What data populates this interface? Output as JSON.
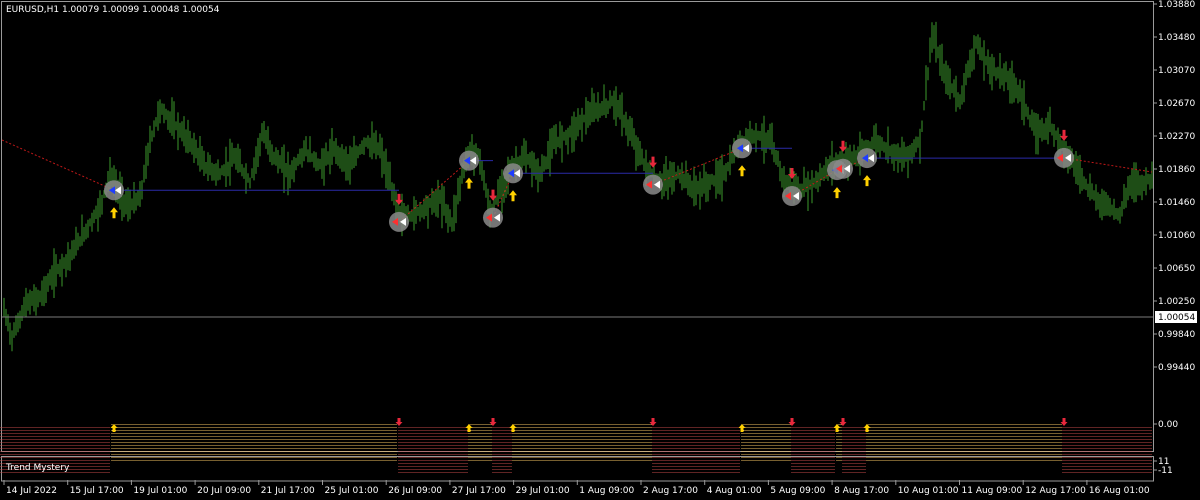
{
  "window": {
    "symbol_header": "EURUSD,H1  1.00079 1.00099 1.00048 1.00054",
    "current_price": "1.00054"
  },
  "price_axis": {
    "labels": [
      "1.03880",
      "1.03480",
      "1.03070",
      "1.02670",
      "1.02270",
      "1.01860",
      "1.01460",
      "1.01060",
      "1.00650",
      "1.00250",
      "0.99840",
      "0.99440"
    ]
  },
  "indicator": {
    "name": "Trend Mystery",
    "axis_labels": [
      "11",
      "0.00",
      "-11"
    ]
  },
  "time_axis": {
    "labels": [
      "14 Jul 2022",
      "15 Jul 17:00",
      "19 Jul 01:00",
      "20 Jul 09:00",
      "21 Jul 17:00",
      "25 Jul 01:00",
      "26 Jul 09:00",
      "27 Jul 17:00",
      "29 Jul 01:00",
      "1 Aug 09:00",
      "2 Aug 17:00",
      "4 Aug 01:00",
      "5 Aug 09:00",
      "8 Aug 17:00",
      "10 Aug 01:00",
      "11 Aug 09:00",
      "12 Aug 17:00",
      "16 Aug 01:00"
    ]
  },
  "colors": {
    "background": "#000000",
    "grid": "#232323",
    "candles": "#3c9a2c",
    "bull_histogram": "#f0c060",
    "bear_histogram": "#c04848",
    "buy_arrow": "#ffd000",
    "sell_arrow": "#e8283c",
    "trend_line_flat": "#2a2aa8",
    "trend_line_dotted": "#c01818"
  },
  "chart_data": {
    "type": "line",
    "title": "EURUSD,H1",
    "ylim": [
      0.9944,
      1.0388
    ],
    "price_path": [
      [
        0,
        1.003
      ],
      [
        12,
        0.998
      ],
      [
        25,
        1.002
      ],
      [
        40,
        1.003
      ],
      [
        55,
        1.006
      ],
      [
        70,
        1.008
      ],
      [
        85,
        1.011
      ],
      [
        100,
        1.014
      ],
      [
        110,
        1.018
      ],
      [
        118,
        1.016
      ],
      [
        128,
        1.014
      ],
      [
        140,
        1.015
      ],
      [
        150,
        1.022
      ],
      [
        160,
        1.026
      ],
      [
        175,
        1.024
      ],
      [
        190,
        1.022
      ],
      [
        205,
        1.019
      ],
      [
        220,
        1.018
      ],
      [
        235,
        1.02
      ],
      [
        250,
        1.017
      ],
      [
        262,
        1.023
      ],
      [
        275,
        1.02
      ],
      [
        290,
        1.018
      ],
      [
        305,
        1.021
      ],
      [
        320,
        1.019
      ],
      [
        335,
        1.021
      ],
      [
        350,
        1.019
      ],
      [
        365,
        1.022
      ],
      [
        380,
        1.021
      ],
      [
        392,
        1.016
      ],
      [
        400,
        1.013
      ],
      [
        412,
        1.013
      ],
      [
        425,
        1.014
      ],
      [
        440,
        1.015
      ],
      [
        452,
        1.012
      ],
      [
        462,
        1.018
      ],
      [
        470,
        1.021
      ],
      [
        480,
        1.02
      ],
      [
        490,
        1.013
      ],
      [
        500,
        1.016
      ],
      [
        512,
        1.019
      ],
      [
        525,
        1.02
      ],
      [
        540,
        1.018
      ],
      [
        555,
        1.022
      ],
      [
        570,
        1.023
      ],
      [
        585,
        1.025
      ],
      [
        600,
        1.026
      ],
      [
        615,
        1.027
      ],
      [
        630,
        1.023
      ],
      [
        645,
        1.019
      ],
      [
        660,
        1.017
      ],
      [
        680,
        1.018
      ],
      [
        695,
        1.016
      ],
      [
        710,
        1.017
      ],
      [
        725,
        1.018
      ],
      [
        740,
        1.022
      ],
      [
        755,
        1.023
      ],
      [
        770,
        1.022
      ],
      [
        785,
        1.017
      ],
      [
        800,
        1.016
      ],
      [
        815,
        1.017
      ],
      [
        830,
        1.019
      ],
      [
        845,
        1.02
      ],
      [
        860,
        1.02
      ],
      [
        875,
        1.022
      ],
      [
        890,
        1.021
      ],
      [
        905,
        1.02
      ],
      [
        920,
        1.022
      ],
      [
        932,
        1.035
      ],
      [
        945,
        1.03
      ],
      [
        960,
        1.027
      ],
      [
        975,
        1.034
      ],
      [
        990,
        1.031
      ],
      [
        1005,
        1.03
      ],
      [
        1020,
        1.028
      ],
      [
        1035,
        1.023
      ],
      [
        1050,
        1.024
      ],
      [
        1065,
        1.021
      ],
      [
        1080,
        1.018
      ],
      [
        1095,
        1.015
      ],
      [
        1110,
        1.014
      ],
      [
        1120,
        1.013
      ],
      [
        1130,
        1.017
      ],
      [
        1145,
        1.017
      ],
      [
        1155,
        1.018
      ]
    ]
  },
  "signals": [
    {
      "kind": "buy",
      "x": 114
    },
    {
      "kind": "sell",
      "x": 399
    },
    {
      "kind": "buy",
      "x": 469
    },
    {
      "kind": "sell",
      "x": 493
    },
    {
      "kind": "buy",
      "x": 513
    },
    {
      "kind": "sell",
      "x": 653
    },
    {
      "kind": "buy",
      "x": 742
    },
    {
      "kind": "sell",
      "x": 792
    },
    {
      "kind": "buy",
      "x": 837
    },
    {
      "kind": "sell",
      "x": 843
    },
    {
      "kind": "buy",
      "x": 867
    },
    {
      "kind": "sell",
      "x": 1064
    }
  ],
  "histogram_segments": [
    {
      "dir": "bear",
      "x0": 0,
      "x1": 111
    },
    {
      "dir": "bull",
      "x0": 111,
      "x1": 398
    },
    {
      "dir": "bear",
      "x0": 398,
      "x1": 468
    },
    {
      "dir": "bull",
      "x0": 468,
      "x1": 492
    },
    {
      "dir": "bear",
      "x0": 492,
      "x1": 512
    },
    {
      "dir": "bull",
      "x0": 512,
      "x1": 652
    },
    {
      "dir": "bear",
      "x0": 652,
      "x1": 741
    },
    {
      "dir": "bull",
      "x0": 741,
      "x1": 791
    },
    {
      "dir": "bear",
      "x0": 791,
      "x1": 836
    },
    {
      "dir": "bull",
      "x0": 836,
      "x1": 842
    },
    {
      "dir": "bear",
      "x0": 842,
      "x1": 866
    },
    {
      "dir": "bull",
      "x0": 866,
      "x1": 1062
    },
    {
      "dir": "bear",
      "x0": 1062,
      "x1": 1153
    }
  ]
}
